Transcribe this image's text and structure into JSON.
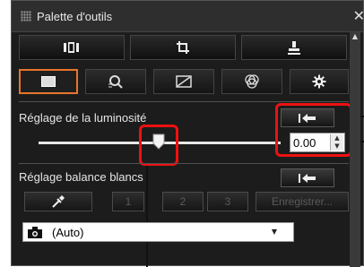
{
  "window": {
    "title": "Palette d'outils",
    "close_glyph": "✕"
  },
  "toolbar": {
    "buttons": [
      {
        "icon": "filmstrip-icon"
      },
      {
        "icon": "crop-icon"
      },
      {
        "icon": "stamp-icon"
      }
    ]
  },
  "tabs": [
    {
      "icon": "basic-adjust-icon",
      "active": true
    },
    {
      "icon": "tone-curve-icon",
      "active": false
    },
    {
      "icon": "color-adjust-icon",
      "active": false
    },
    {
      "icon": "detail-icon",
      "active": false
    },
    {
      "icon": "settings-icon",
      "active": false
    }
  ],
  "brightness": {
    "label": "Réglage de la luminosité",
    "value": "0.00",
    "slider_level": 0.5
  },
  "white_balance": {
    "label": "Réglage balance blancs",
    "slot_labels": [
      "1",
      "2",
      "3"
    ],
    "register_label": "Enregistrer..."
  },
  "wb_select": {
    "value": "(Auto)"
  },
  "colors": {
    "accent": "#e8742b",
    "highlight": "#ee1111"
  }
}
